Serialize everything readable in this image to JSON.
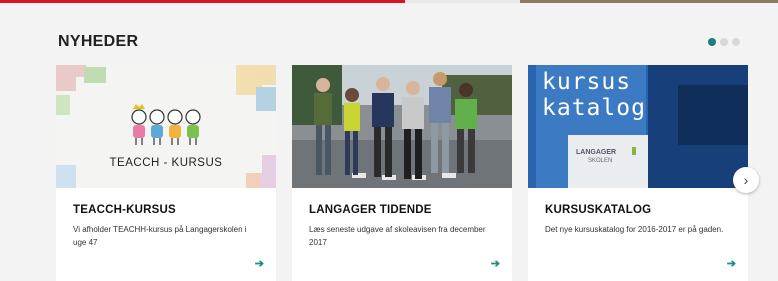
{
  "section": {
    "title": "NYHEDER"
  },
  "carousel": {
    "dot_count": 3,
    "active_index": 0
  },
  "cards": [
    {
      "image_caption": "TEACCH - KURSUS",
      "title": "TEACCH-KURSUS",
      "description": "Vi afholder TEACHH-kursus på Langagerskolen i uge 47",
      "arrow_icon": "arrow-right-icon"
    },
    {
      "title": "LANGAGER TIDENDE",
      "description": "Læs seneste udgave af skoleavisen fra december 2017",
      "arrow_icon": "arrow-right-icon"
    },
    {
      "image_text_line1": "kursus",
      "image_text_line2": "katalog",
      "image_logo_line1": "LANGAGER",
      "image_logo_line2": "SKOLEN",
      "title": "KURSUSKATALOG",
      "description": "Det nye kursuskatalog for 2016-2017 er på gaden.",
      "arrow_icon": "arrow-right-icon"
    }
  ],
  "colors": {
    "accent": "#1a7e79",
    "brand_red": "#d7141f"
  }
}
